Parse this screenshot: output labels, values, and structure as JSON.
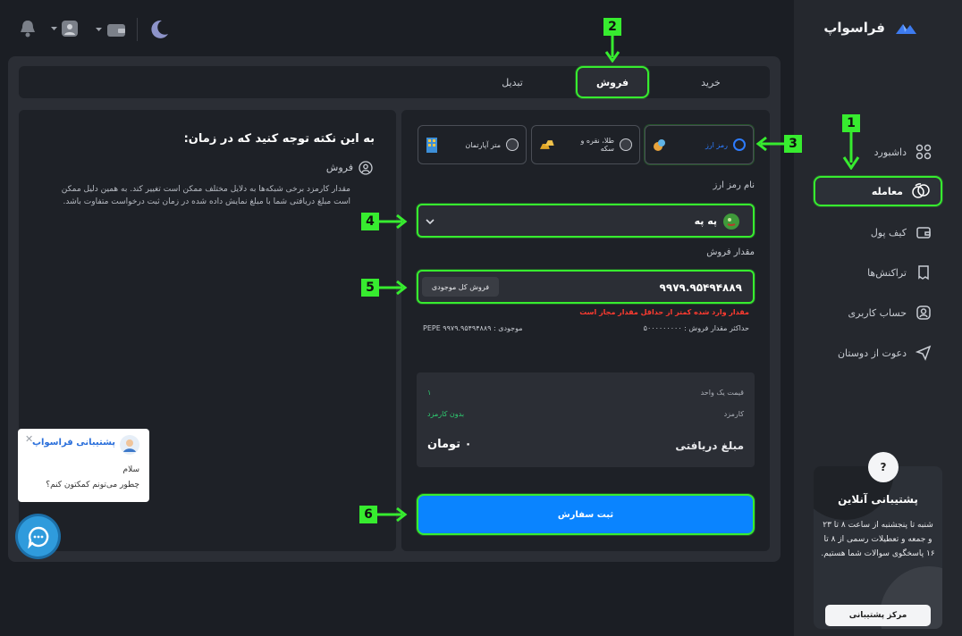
{
  "brand": {
    "name": "فراسواپ"
  },
  "sidebar": {
    "items": [
      {
        "label": "داشبورد",
        "icon": "dashboard-grid-icon"
      },
      {
        "label": "معامله",
        "icon": "exchange-coins-icon",
        "active": true
      },
      {
        "label": "کیف پول",
        "icon": "wallet-icon"
      },
      {
        "label": "تراکنش‌ها",
        "icon": "receipt-icon"
      },
      {
        "label": "حساب کاربری",
        "icon": "user-icon"
      },
      {
        "label": "دعوت از دوستان",
        "icon": "send-icon"
      }
    ],
    "support": {
      "question_mark": "?",
      "title": "پشتیبانی آنلاین",
      "text": "شنبه تا پنجشنبه از ساعت ۸ تا ۲۳ و جمعه و تعطیلات رسمی از ۸ تا ۱۶ پاسخگوی سوالات شما هستیم.",
      "button": "مرکز پشتیبانی"
    }
  },
  "topbar": {
    "icons": [
      "moon-icon",
      "wallet-icon",
      "user-icon",
      "bell-icon"
    ]
  },
  "tabs": [
    {
      "label": "خرید"
    },
    {
      "label": "فروش",
      "active": true
    },
    {
      "label": "تبدیل"
    }
  ],
  "form": {
    "assets": [
      {
        "label": "رمز ارز",
        "selected": true
      },
      {
        "label": "طلا، نقره و سکه",
        "selected": false
      },
      {
        "label": "متر آپارتمان",
        "selected": false
      }
    ],
    "currency_label": "نام رمز ارز",
    "currency_value": "په په",
    "amount_label": "مقدار فروش",
    "amount_value": "۹۹۷۹.۹۵۴۹۴۸۸۹",
    "sell_all": "فروش کل موجودی",
    "error": "مقدار وارد شده کمتر از حداقل مقدار مجاز است",
    "max_sell": "حداکثر مقدار فروش : ۵۰۰۰۰۰۰۰۰۰",
    "balance": "موجودی : PEPE ۹۹۷۹.۹۵۴۹۴۸۸۹",
    "summary": {
      "unit_price_label": "قیمت یک واحد",
      "unit_price_value": "۱",
      "fee_label": "کارمزد",
      "fee_value": "بدون کارمزد",
      "receive_label": "مبلغ دریافتی",
      "receive_value": "۰ تومان"
    },
    "submit": "ثبت سفارش"
  },
  "info": {
    "title": "به این نکته توجه کنید که در زمان:",
    "section": "فروش",
    "body": "مقدار کارمزد برخی شبکه‌ها به دلایل مختلف ممکن است تغییر کند. به همین دلیل ممکن است مبلغ دریافتی شما با مبلغ نمایش داده شده در زمان ثبت درخواست متفاوت باشد."
  },
  "chat": {
    "title": "پشتیبانی فراسواپ",
    "line1": "سلام",
    "line2": "چطور می‌تونم کمکتون کنم؟"
  },
  "markers": [
    "1",
    "2",
    "3",
    "4",
    "5",
    "6"
  ],
  "colors": {
    "accent": "#0a84ff",
    "highlight": "#37ec2f",
    "error": "#ff3b30",
    "success": "#2ecc71"
  }
}
